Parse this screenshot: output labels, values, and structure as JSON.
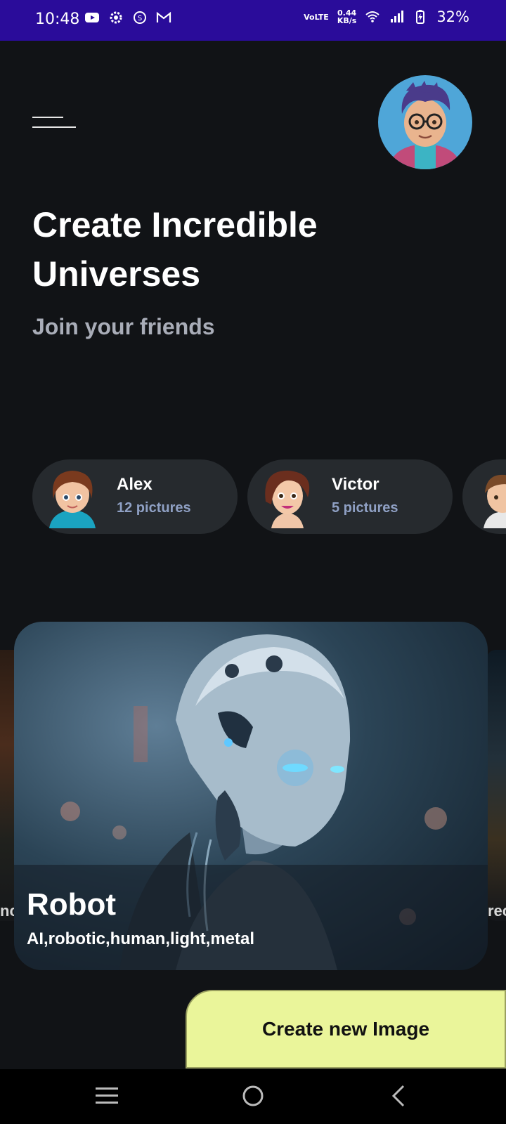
{
  "status_bar": {
    "time": "10:48",
    "network_type": "VoLTE",
    "data_speed_value": "0.44",
    "data_speed_unit": "KB/s",
    "battery": "32%",
    "icons": [
      "youtube-icon",
      "settings-gear-icon",
      "sync-icon",
      "gmail-icon",
      "wifi-icon",
      "signal-icon",
      "battery-charging-icon"
    ]
  },
  "header": {
    "menu_icon": "hamburger-menu-icon",
    "avatar": "user-avatar"
  },
  "hero": {
    "title": " Create Incredible\nUniverses",
    "subtitle": "Join your friends"
  },
  "friends": [
    {
      "name": "Alex",
      "count": "12 pictures"
    },
    {
      "name": "Victor",
      "count": "5 pictures"
    }
  ],
  "gallery": {
    "left_peek_label": "nc",
    "right_peek_label": "rec",
    "featured": {
      "name": "Robot",
      "tags": "AI,robotic,human,light,metal"
    }
  },
  "actions": {
    "create_label": "Create new Image"
  },
  "nav": {
    "icons": [
      "recent-apps-icon",
      "home-icon",
      "back-icon"
    ]
  },
  "colors": {
    "status_bar": "#2a0c9a",
    "background": "#111316",
    "chip": "#262a2e",
    "accent_button": "#eaf59a",
    "muted_text": "#a9adb8"
  }
}
